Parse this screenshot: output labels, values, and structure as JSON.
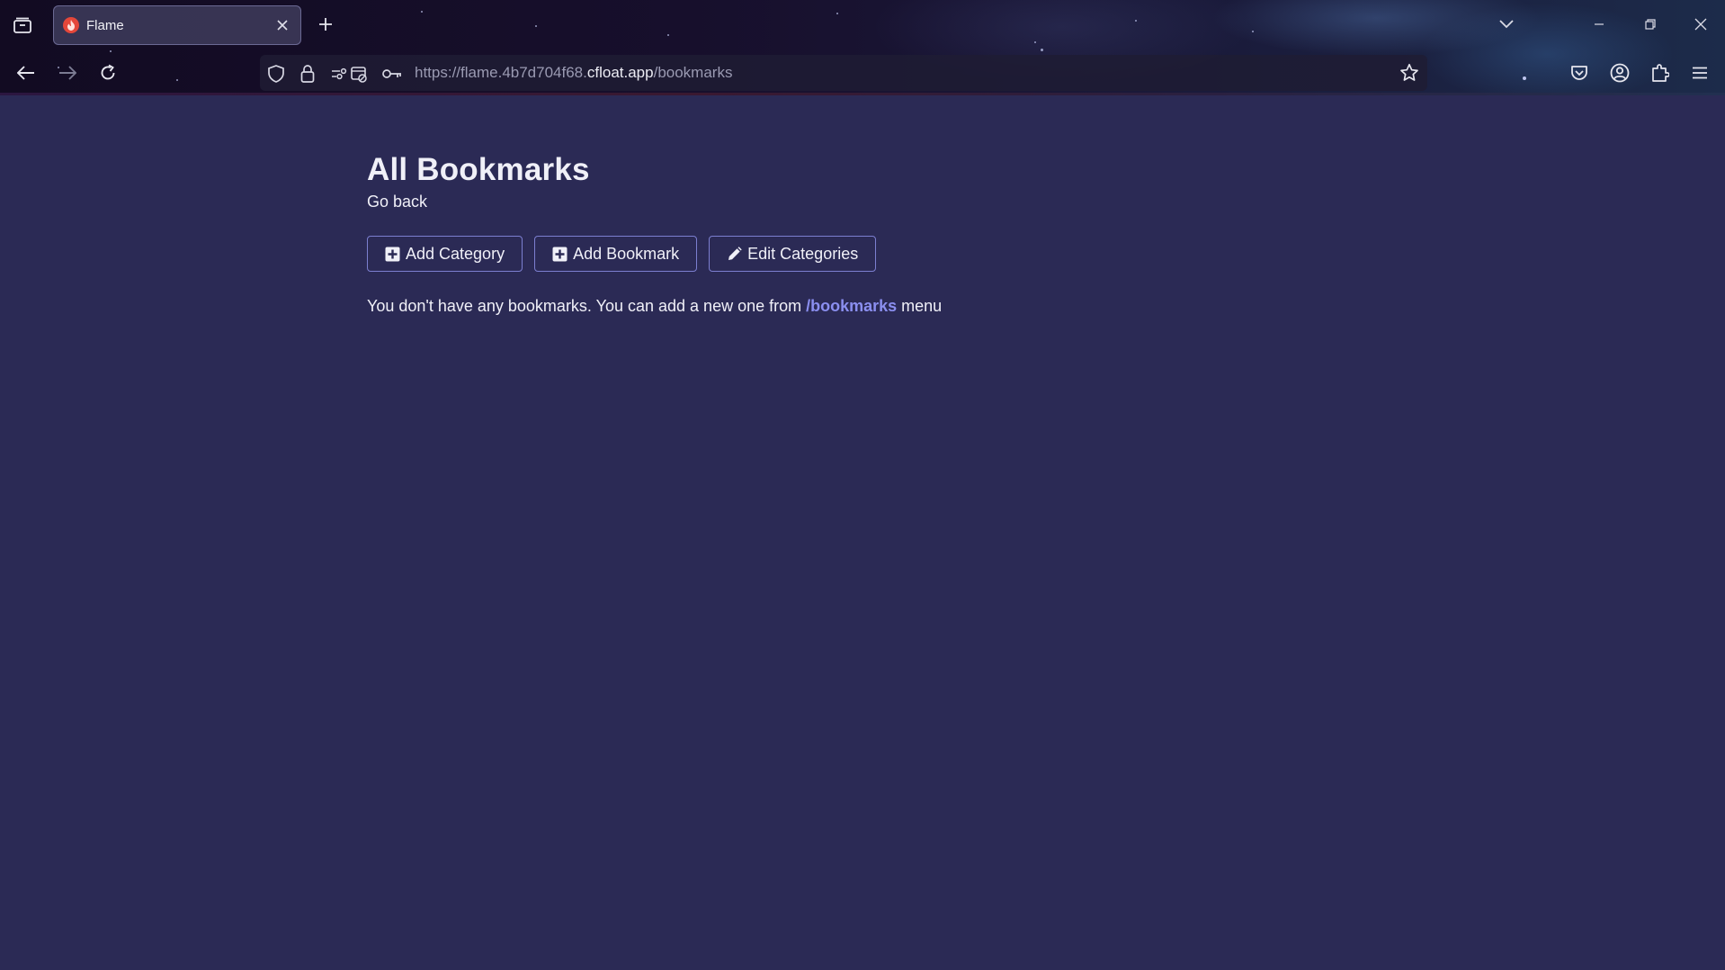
{
  "browser": {
    "tab": {
      "title": "Flame",
      "favicon": "flame-icon"
    },
    "url": {
      "prefix": "https://flame.4b7d704f68.",
      "host": "cfloat.app",
      "path": "/bookmarks"
    },
    "icons": {
      "tab_list": "tab-list-icon",
      "new_tab": "plus-icon",
      "back": "arrow-left-icon",
      "forward": "arrow-right-icon",
      "reload": "reload-icon",
      "tracking": "shield-icon",
      "lock": "lock-icon",
      "permissions": "permissions-icon",
      "key": "key-icon",
      "bookmark_star": "star-icon",
      "pocket": "pocket-icon",
      "account": "account-icon",
      "extensions": "puzzle-icon",
      "menu": "hamburger-icon"
    }
  },
  "page": {
    "title": "All Bookmarks",
    "go_back": "Go back",
    "buttons": [
      {
        "label": "Add Category",
        "icon": "plus-square-icon"
      },
      {
        "label": "Add Bookmark",
        "icon": "plus-square-icon"
      },
      {
        "label": "Edit Categories",
        "icon": "pencil-icon"
      }
    ],
    "empty_message": {
      "before": "You don't have any bookmarks. You can add a new one from ",
      "link": "/bookmarks",
      "after": " menu"
    }
  },
  "colors": {
    "background": "#2b2a55",
    "button_border": "#7c7fd0",
    "link": "#8b8ff0"
  }
}
